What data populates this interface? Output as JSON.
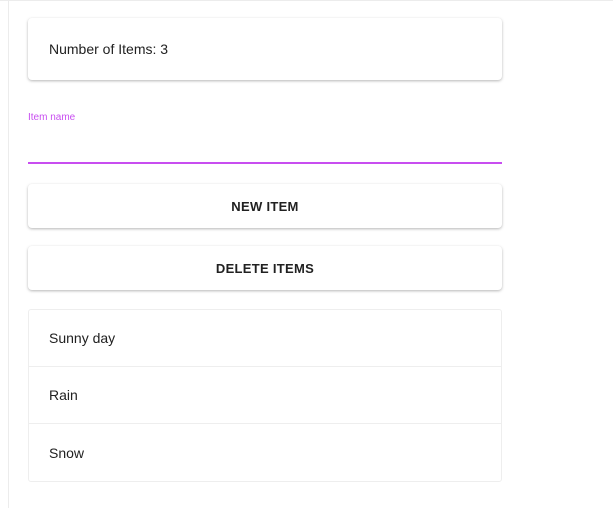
{
  "counter": {
    "label": "Number of Items: 3"
  },
  "item_field": {
    "label": "Item name",
    "value": "",
    "accent_color": "#c84ef0"
  },
  "buttons": {
    "new_item": "NEW ITEM",
    "delete_items": "DELETE ITEMS"
  },
  "items": [
    "Sunny day",
    "Rain",
    "Snow"
  ]
}
